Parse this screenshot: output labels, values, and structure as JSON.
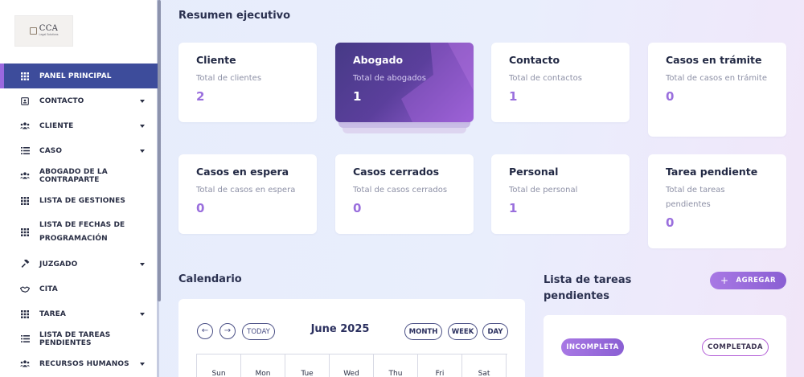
{
  "sidebar": {
    "logo": {
      "text": "CCA",
      "tagline": "Legal Solutions"
    },
    "items": [
      {
        "label": "PANEL PRINCIPAL",
        "icon": "grid-icon",
        "active": true,
        "caret": false
      },
      {
        "label": "CONTACTO",
        "icon": "contact-card-icon",
        "caret": true
      },
      {
        "label": "CLIENTE",
        "icon": "users-icon",
        "caret": true
      },
      {
        "label": "CASO",
        "icon": "list-icon",
        "caret": true
      },
      {
        "label": "ABOGADO DE LA CONTRAPARTE",
        "icon": "users-icon",
        "caret": false
      },
      {
        "label": "LISTA DE GESTIONES",
        "icon": "grid-icon",
        "caret": false
      },
      {
        "label": "LISTA DE FECHAS DE PROGRAMACIÓN",
        "icon": "grid-icon",
        "caret": false
      },
      {
        "label": "JUZGADO",
        "icon": "gavel-icon",
        "caret": true
      },
      {
        "label": "CITA",
        "icon": "handshake-icon",
        "caret": false
      },
      {
        "label": "TAREA",
        "icon": "grid-icon",
        "caret": true
      },
      {
        "label": "LISTA DE TAREAS PENDIENTES",
        "icon": "list-icon",
        "caret": false
      },
      {
        "label": "RECURSOS HUMANOS",
        "icon": "users-icon",
        "caret": true
      }
    ]
  },
  "summary": {
    "title": "Resumen ejecutivo",
    "cards": [
      {
        "title": "Cliente",
        "subtitle": "Total de clientes",
        "value": "2"
      },
      {
        "title": "Abogado",
        "subtitle": "Total de abogados",
        "value": "1"
      },
      {
        "title": "Contacto",
        "subtitle": "Total de contactos",
        "value": "1"
      },
      {
        "title": "Casos en trámite",
        "subtitle": "Total de casos en trámite",
        "value": "0"
      },
      {
        "title": "Casos en espera",
        "subtitle": "Total de casos en espera",
        "value": "0"
      },
      {
        "title": "Casos cerrados",
        "subtitle": "Total de casos cerrados",
        "value": "0"
      },
      {
        "title": "Personal",
        "subtitle": "Total de personal",
        "value": "1"
      },
      {
        "title": "Tarea pendiente",
        "subtitle": "Total de tareas pendientes",
        "value": "0"
      }
    ]
  },
  "calendar": {
    "title": "Calendario",
    "month_title": "June 2025",
    "today": "TODAY",
    "views": {
      "month": "MONTH",
      "week": "WEEK",
      "day": "DAY"
    },
    "days": [
      "Sun",
      "Mon",
      "Tue",
      "Wed",
      "Thu",
      "Fri",
      "Sat"
    ]
  },
  "tasks": {
    "title": "Lista de tareas pendientes",
    "add_label": "AGREGAR",
    "incomplete_label": "INCOMPLETA",
    "complete_label": "COMPLETADA"
  },
  "colors": {
    "accent": "#9a6fdd",
    "active_nav": "#3d4c9b"
  }
}
